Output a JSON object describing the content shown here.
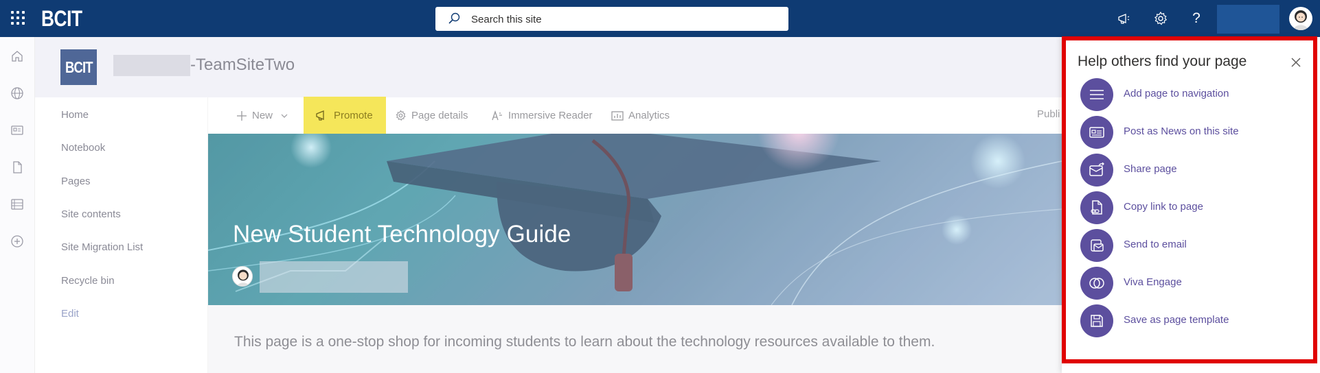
{
  "suite_bar": {
    "brand": "BCIT",
    "search_placeholder": "Search this site",
    "help_glyph": "?",
    "icons": [
      "waffle-icon",
      "megaphone-icon",
      "gear-icon",
      "help-icon",
      "avatar"
    ]
  },
  "site": {
    "logo_text": "BCIT",
    "title_suffix": "-TeamSiteTwo"
  },
  "left_nav": {
    "items": [
      "Home",
      "Notebook",
      "Pages",
      "Site contents",
      "Site Migration List",
      "Recycle bin"
    ],
    "edit_label": "Edit"
  },
  "command_bar": {
    "new_label": "New",
    "promote_label": "Promote",
    "page_details_label": "Page details",
    "immersive_reader_label": "Immersive Reader",
    "analytics_label": "Analytics",
    "publish_label": "Publi"
  },
  "hero": {
    "title": "New Student Technology Guide"
  },
  "page": {
    "intro": "This page is a one-stop shop for incoming students to learn about the technology resources available to them."
  },
  "promote_panel": {
    "title": "Help others find your page",
    "actions": [
      {
        "label": "Add page to navigation",
        "icon": "navigation-icon"
      },
      {
        "label": "Post as News on this site",
        "icon": "news-icon"
      },
      {
        "label": "Share page",
        "icon": "share-icon"
      },
      {
        "label": "Copy link to page",
        "icon": "copy-link-icon"
      },
      {
        "label": "Send to email",
        "icon": "email-icon"
      },
      {
        "label": "Viva Engage",
        "icon": "viva-engage-icon"
      },
      {
        "label": "Save as page template",
        "icon": "save-icon"
      }
    ]
  },
  "colors": {
    "suite_bar": "#0f3b73",
    "accent": "#5c4f9e",
    "promote_highlight": "#f5e65a",
    "outline": "#e00000"
  }
}
